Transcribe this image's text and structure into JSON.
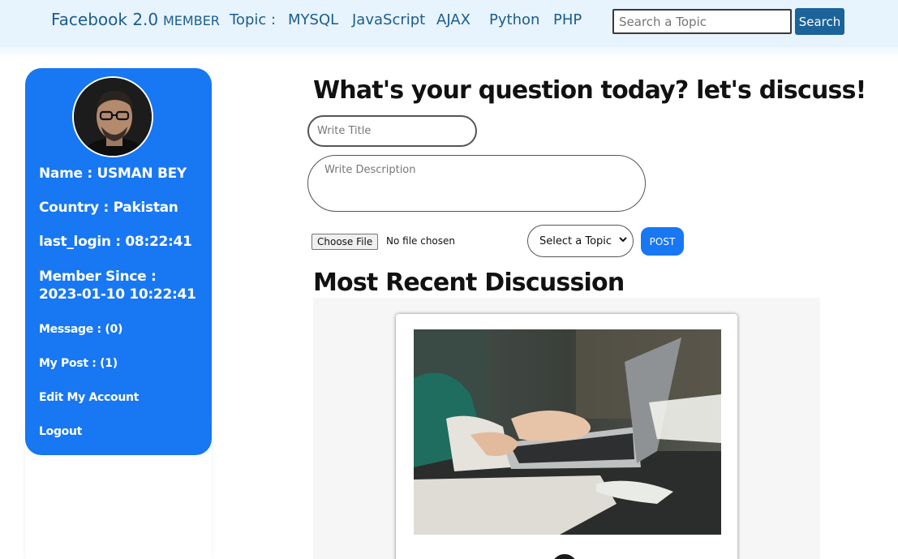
{
  "nav": {
    "brand": "Facebook 2.0",
    "member": "MEMBER",
    "topic_label": "Topic :",
    "topics": [
      "MYSQL",
      "JavaScript",
      "AJAX",
      "Python",
      "PHP"
    ],
    "search_placeholder": "Search a Topic",
    "search_button": "Search"
  },
  "profile": {
    "name": "Name : USMAN BEY",
    "country": "Country : Pakistan",
    "last_login": "last_login : 08:22:41",
    "member_since": "Member Since : 2023-01-10 10:22:41",
    "message": "Message : (0)",
    "my_post": "My Post : (1)",
    "edit_account": "Edit My Account",
    "logout": "Logout"
  },
  "form": {
    "heading": "What's your question today? let's discuss!",
    "title_placeholder": "Write Title",
    "description_placeholder": "Write Description",
    "file_button": "Choose File",
    "file_status": "No file chosen",
    "topic_select": "Select a Topic",
    "post_button": "POST"
  },
  "discussion": {
    "heading": "Most Recent Discussion"
  },
  "colors": {
    "nav_bg": "#e7f3fd",
    "nav_text": "#1c5d8d",
    "accent": "#1877f2",
    "search_button": "#1c6399"
  }
}
